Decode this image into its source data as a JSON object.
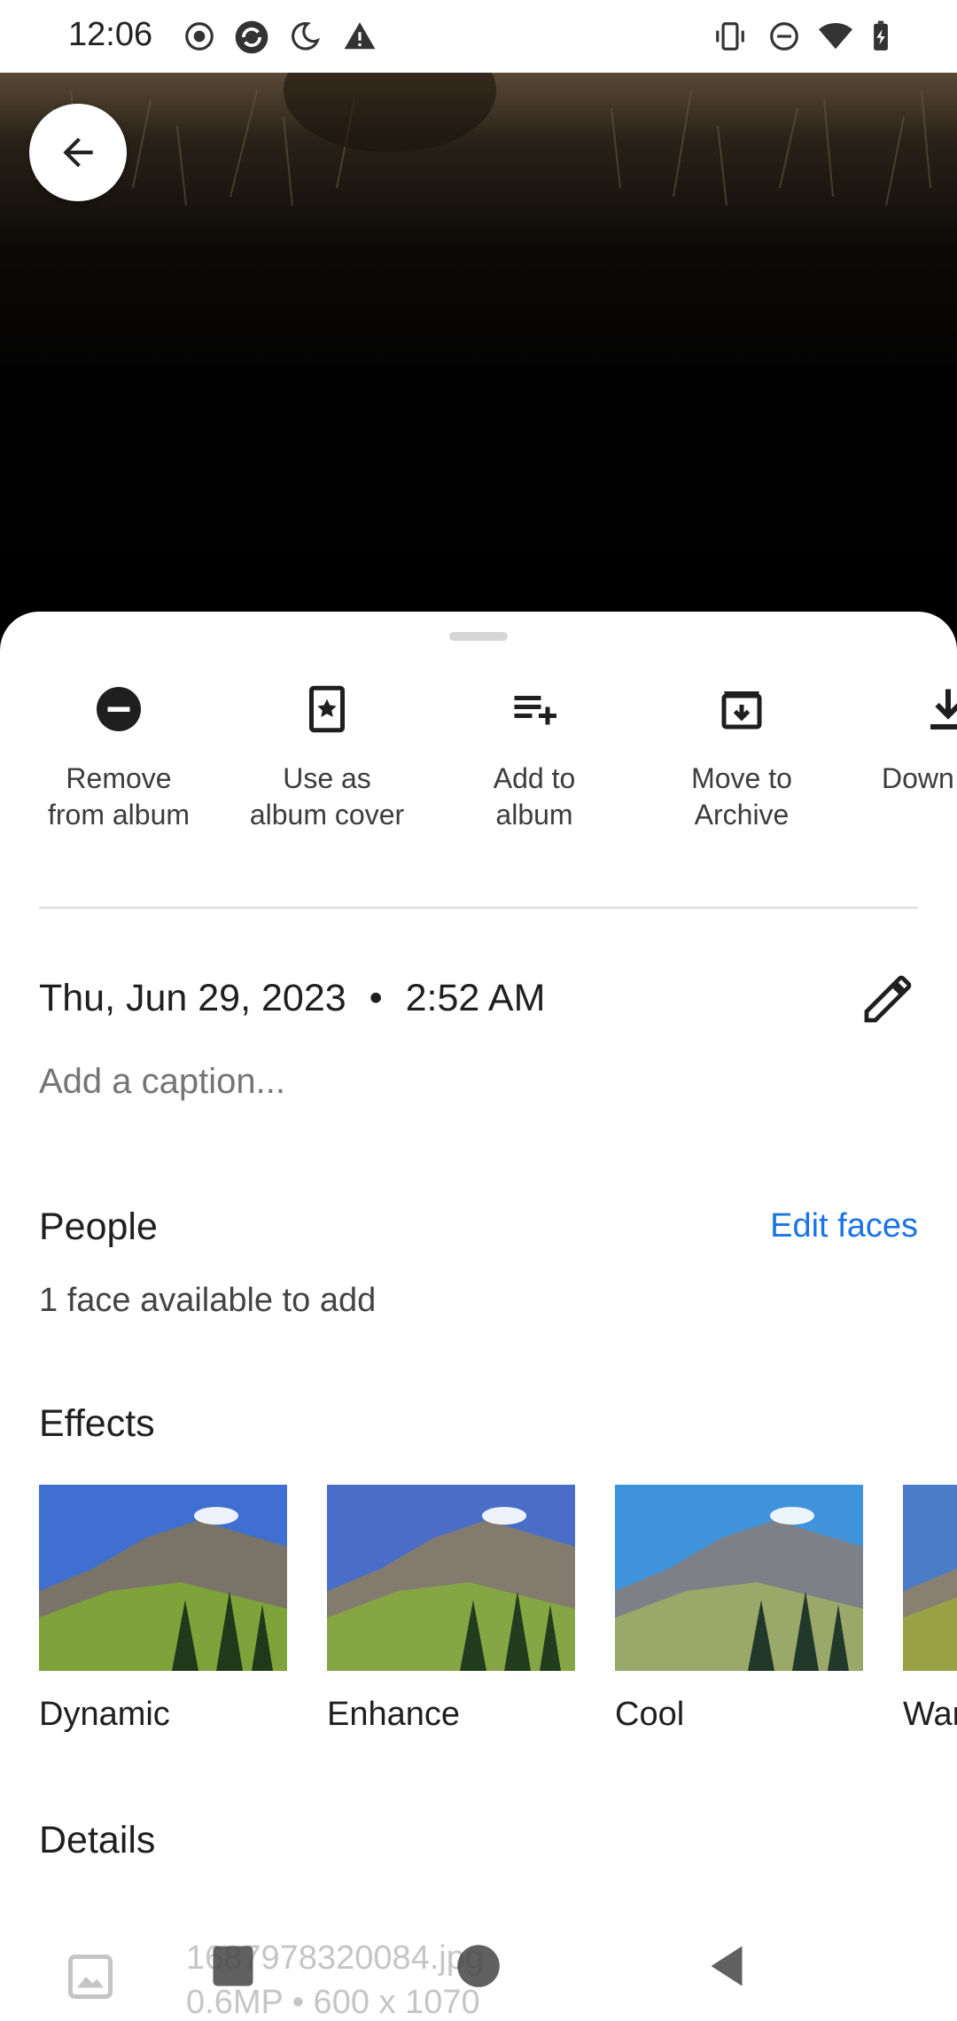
{
  "status_bar": {
    "time": "12:06",
    "left_icons": [
      "record-icon",
      "sync-icon",
      "night-mode-icon",
      "warning-icon"
    ],
    "right_icons": [
      "vibrate-icon",
      "do-not-disturb-icon",
      "wifi-icon",
      "battery-charging-icon"
    ]
  },
  "actions": [
    {
      "label": "Remove\nfrom album",
      "icon": "remove-circle-icon"
    },
    {
      "label": "Use as\nalbum cover",
      "icon": "album-cover-star-icon"
    },
    {
      "label": "Add to\nalbum",
      "icon": "playlist-add-icon"
    },
    {
      "label": "Move to\nArchive",
      "icon": "archive-icon"
    },
    {
      "label": "Down",
      "icon": "download-icon"
    }
  ],
  "info": {
    "date": "Thu, Jun 29, 2023",
    "separator": "•",
    "time": "2:52 AM",
    "caption_placeholder": "Add a caption..."
  },
  "people": {
    "title": "People",
    "edit_faces": "Edit faces",
    "faces_available": "1 face available to add"
  },
  "effects": {
    "title": "Effects",
    "items": [
      "Dynamic",
      "Enhance",
      "Cool",
      "War"
    ]
  },
  "details": {
    "title": "Details",
    "file_name": "1687978320084.jpg",
    "file_meta": "0.6MP • 600 x 1070"
  },
  "colors": {
    "accent": "#1a73e8",
    "text_primary": "#1f1f1f",
    "text_secondary": "#757575"
  }
}
